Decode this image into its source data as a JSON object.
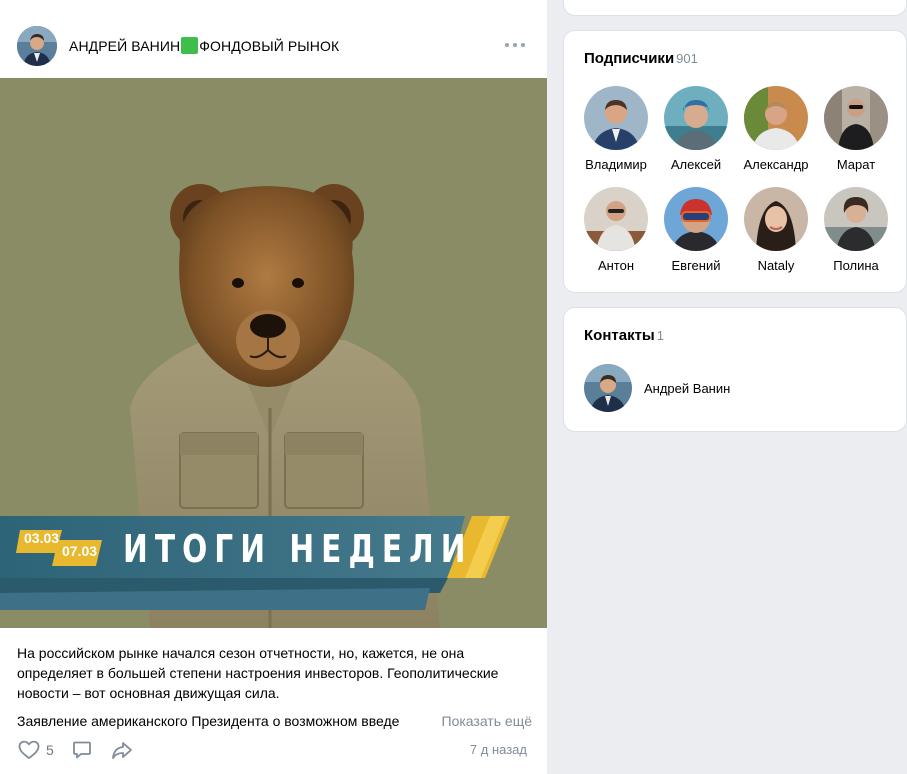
{
  "post": {
    "author": {
      "name_part1": "АНДРЕЙ ВАНИН",
      "name_part2": "ФОНДОВЫЙ РЫНОК",
      "emoji": "green-square"
    },
    "image": {
      "date1": "03.03",
      "date2": "07.03",
      "banner_title": "ИТОГИ НЕДЕЛИ",
      "background_color": "#8a8c66"
    },
    "text": {
      "paragraph1": "На российском рынке начался сезон отчетности, но, кажется, не она определяет в большей степени настроения инвесторов. Геополитические новости – вот основная движущая сила.",
      "paragraph2": "Заявление американского Президента о возможном введе",
      "show_more": "Показать ещё"
    },
    "footer": {
      "likes_count": "5",
      "time": "7 д назад"
    }
  },
  "subscribers": {
    "title": "Подписчики",
    "count": "901",
    "items": [
      {
        "name": "Владимир"
      },
      {
        "name": "Алексей"
      },
      {
        "name": "Александр"
      },
      {
        "name": "Марат"
      },
      {
        "name": "Антон"
      },
      {
        "name": "Евгений"
      },
      {
        "name": "Nataly"
      },
      {
        "name": "Полина"
      }
    ]
  },
  "contacts": {
    "title": "Контакты",
    "count": "1",
    "items": [
      {
        "name": "Андрей Ванин"
      }
    ]
  },
  "colors": {
    "page_bg": "#ebedf0",
    "secondary_text": "#818c99",
    "banner_teal": "#3e7187",
    "banner_yellow": "#e8b92e"
  }
}
